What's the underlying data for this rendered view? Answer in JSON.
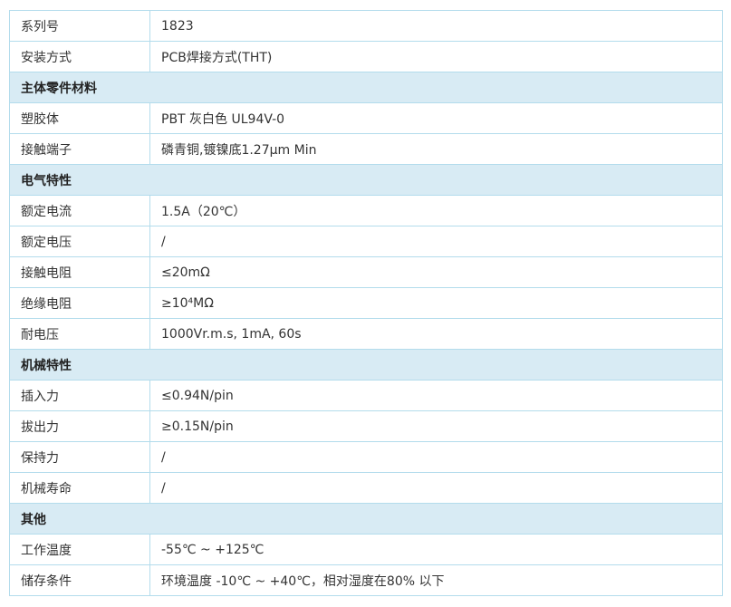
{
  "rows": [
    {
      "type": "row",
      "label": "系列号",
      "value": "1823"
    },
    {
      "type": "row",
      "label": "安装方式",
      "value": "PCB焊接方式(THT)"
    },
    {
      "type": "section",
      "label": "主体零件材料"
    },
    {
      "type": "row",
      "label": "塑胶体",
      "value": "PBT 灰白色 UL94V-0"
    },
    {
      "type": "row",
      "label": "接触端子",
      "value": "磷青铜,镀镍底1.27μm Min"
    },
    {
      "type": "section",
      "label": "电气特性"
    },
    {
      "type": "row",
      "label": "额定电流",
      "value": "1.5A（20℃）"
    },
    {
      "type": "row",
      "label": "额定电压",
      "value": "/"
    },
    {
      "type": "row",
      "label": "接触电阻",
      "value": "≤20mΩ"
    },
    {
      "type": "row",
      "label": "绝缘电阻",
      "value": "≥10⁴MΩ"
    },
    {
      "type": "row",
      "label": "耐电压",
      "value": "1000Vr.m.s, 1mA, 60s"
    },
    {
      "type": "section",
      "label": "机械特性"
    },
    {
      "type": "row",
      "label": "插入力",
      "value": "≤0.94N/pin"
    },
    {
      "type": "row",
      "label": "拔出力",
      "value": "≥0.15N/pin"
    },
    {
      "type": "row",
      "label": "保持力",
      "value": "/"
    },
    {
      "type": "row",
      "label": "机械寿命",
      "value": "/"
    },
    {
      "type": "section",
      "label": "其他"
    },
    {
      "type": "row",
      "label": "工作温度",
      "value": "-55℃ ~ +125℃"
    },
    {
      "type": "row",
      "label": "储存条件",
      "value": "环境温度 -10℃ ~ +40℃，相对湿度在80% 以下"
    }
  ],
  "colors": {
    "border": "#b3dcec",
    "section_background": "#d8ebf4",
    "text": "#333333"
  }
}
